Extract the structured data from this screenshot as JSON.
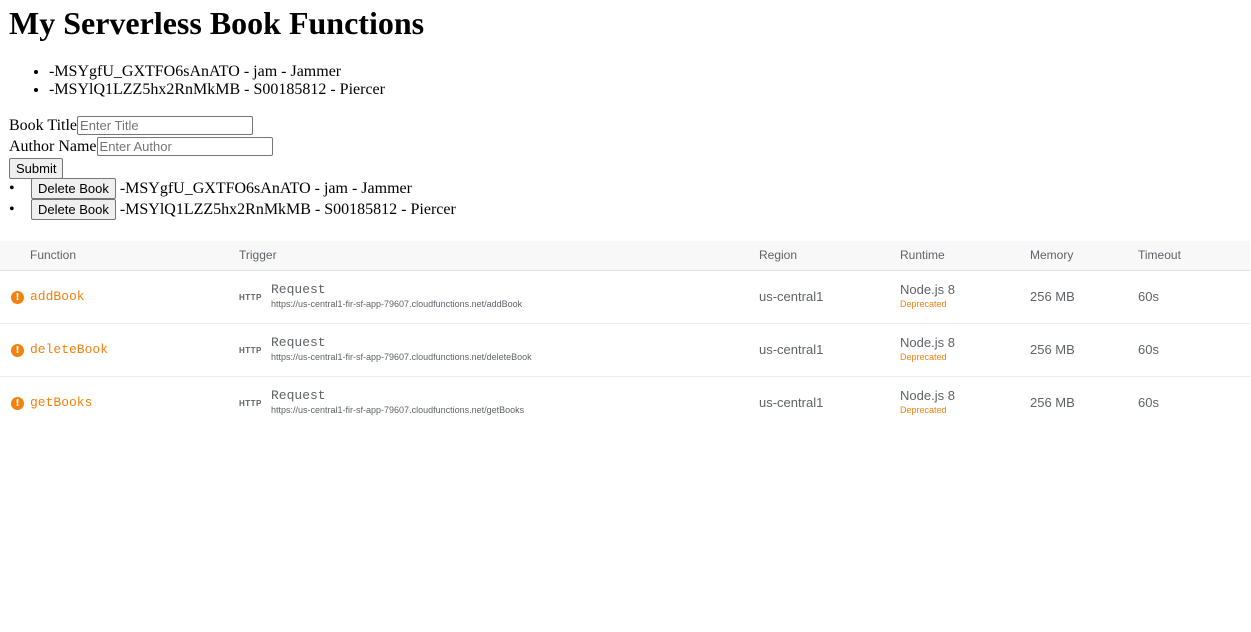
{
  "title": "My Serverless Book Functions",
  "books": [
    {
      "text": "-MSYgfU_GXTFO6sAnATO - jam - Jammer"
    },
    {
      "text": "-MSYlQ1LZZ5hx2RnMkMB - S00185812 - Piercer"
    }
  ],
  "form": {
    "title_label": "Book Title",
    "title_placeholder": "Enter Title",
    "title_value": "",
    "author_label": "Author Name",
    "author_placeholder": "Enter Author",
    "author_value": "",
    "submit_label": "Submit"
  },
  "delete_list": {
    "button_label": "Delete Book",
    "items": [
      {
        "text": "-MSYgfU_GXTFO6sAnATO - jam - Jammer"
      },
      {
        "text": "-MSYlQ1LZZ5hx2RnMkMB - S00185812 - Piercer"
      }
    ]
  },
  "table": {
    "headers": {
      "function": "Function",
      "trigger": "Trigger",
      "region": "Region",
      "runtime": "Runtime",
      "memory": "Memory",
      "timeout": "Timeout"
    },
    "rows": [
      {
        "icon": "warning-icon",
        "name": "addBook",
        "trigger_badge": "HTTP",
        "trigger_type": "Request",
        "trigger_url": "https://us-central1-fir-sf-app-79607.cloudfunctions.net/addBook",
        "region": "us-central1",
        "runtime": "Node.js 8",
        "runtime_status": "Deprecated",
        "memory": "256 MB",
        "timeout": "60s"
      },
      {
        "icon": "warning-icon",
        "name": "deleteBook",
        "trigger_badge": "HTTP",
        "trigger_type": "Request",
        "trigger_url": "https://us-central1-fir-sf-app-79607.cloudfunctions.net/deleteBook",
        "region": "us-central1",
        "runtime": "Node.js 8",
        "runtime_status": "Deprecated",
        "memory": "256 MB",
        "timeout": "60s"
      },
      {
        "icon": "warning-icon",
        "name": "getBooks",
        "trigger_badge": "HTTP",
        "trigger_type": "Request",
        "trigger_url": "https://us-central1-fir-sf-app-79607.cloudfunctions.net/getBooks",
        "region": "us-central1",
        "runtime": "Node.js 8",
        "runtime_status": "Deprecated",
        "memory": "256 MB",
        "timeout": "60s"
      }
    ]
  },
  "colors": {
    "warning": "#f2810f",
    "text_secondary": "#5f6368",
    "header_bg": "#f8f8f8"
  }
}
